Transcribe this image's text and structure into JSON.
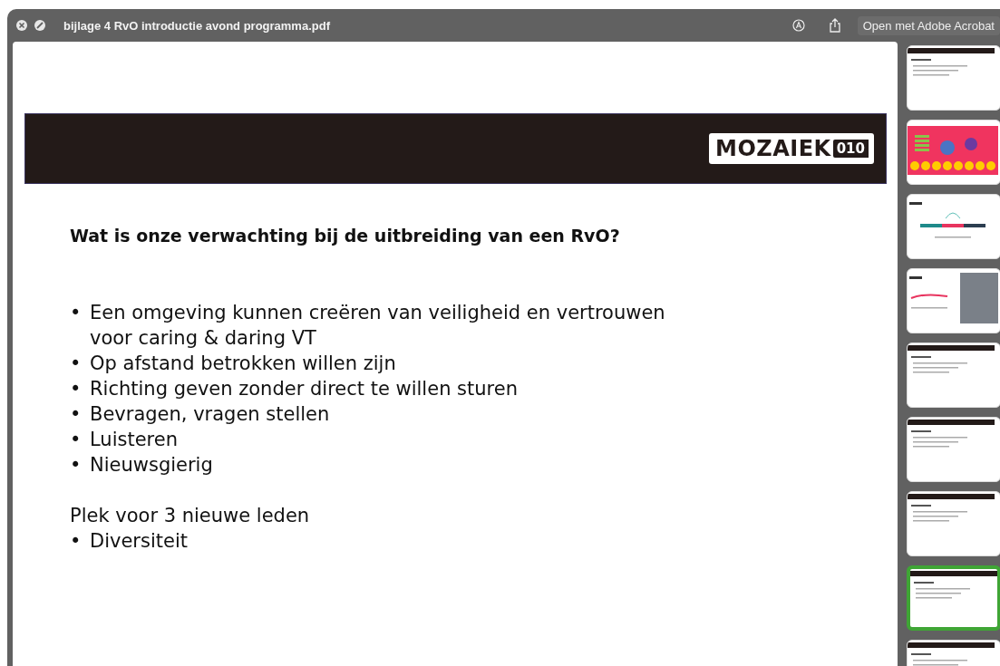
{
  "window": {
    "title": "bijlage 4 RvO introductie avond programma.pdf",
    "open_button": "Open met Adobe Acrobat"
  },
  "slide": {
    "logo": {
      "word": "MOZAIEK",
      "number": "010"
    },
    "heading": "Wat is onze verwachting bij de uitbreiding van een RvO?",
    "bullets": [
      {
        "marker": "•",
        "text": "Een omgeving kunnen creëren van veiligheid en vertrouwen voor caring & daring VT"
      },
      {
        "marker": "•",
        "text": "Op afstand betrokken willen zijn"
      },
      {
        "marker": "•",
        "text": "Richting geven zonder direct te willen sturen"
      },
      {
        "marker": "•",
        "text": "Bevragen, vragen stellen"
      },
      {
        "marker": "•",
        "text": "Luisteren"
      },
      {
        "marker": "•",
        "text": "Nieuwsgierig"
      }
    ],
    "subheading": "Plek voor 3 nieuwe leden",
    "sub_bullets": [
      {
        "marker": "•",
        "text": "Diversiteit"
      }
    ]
  },
  "thumbnails": [
    {
      "kind": "text",
      "selected": false
    },
    {
      "kind": "pink",
      "selected": false
    },
    {
      "kind": "vision",
      "selected": false
    },
    {
      "kind": "photo",
      "selected": false
    },
    {
      "kind": "text",
      "selected": false
    },
    {
      "kind": "text",
      "selected": false
    },
    {
      "kind": "text",
      "selected": false
    },
    {
      "kind": "text",
      "selected": true
    },
    {
      "kind": "text",
      "selected": false
    }
  ]
}
